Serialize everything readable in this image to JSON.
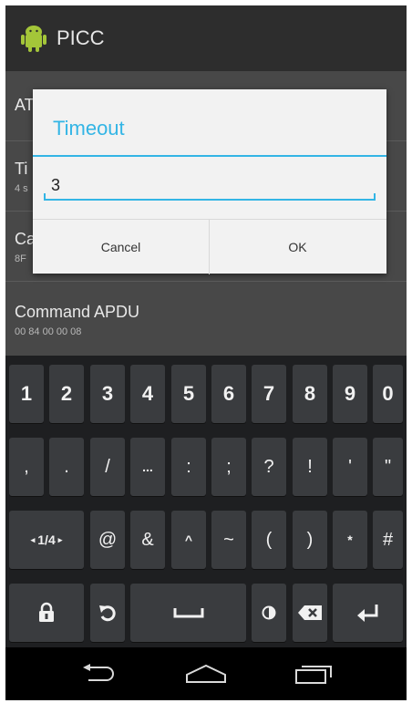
{
  "app": {
    "title": "PICC"
  },
  "preferences": [
    {
      "title": "AT",
      "summary": ""
    },
    {
      "title": "Ti",
      "summary": "4 s"
    },
    {
      "title": "Ca",
      "summary": "8F"
    },
    {
      "title": "Command APDU",
      "summary": "00 84 00 00 08"
    }
  ],
  "dialog": {
    "title": "Timeout",
    "input_value": "3",
    "cancel_label": "Cancel",
    "ok_label": "OK"
  },
  "keyboard": {
    "rows": [
      [
        "1",
        "2",
        "3",
        "4",
        "5",
        "6",
        "7",
        "8",
        "9",
        "0"
      ],
      [
        ",",
        ".",
        "/",
        "...",
        ":",
        ";",
        "?",
        "!",
        "'",
        "\""
      ],
      [
        "1/4",
        "@",
        "&",
        "^",
        "~",
        "(",
        ")",
        "*",
        "#"
      ]
    ]
  },
  "colors": {
    "accent": "#33b5e5",
    "action_bar": "#2d2d2d",
    "dimmed_list": "#484848",
    "keyboard_bg": "#1e1f21",
    "key_bg": "#3a3c3f"
  }
}
